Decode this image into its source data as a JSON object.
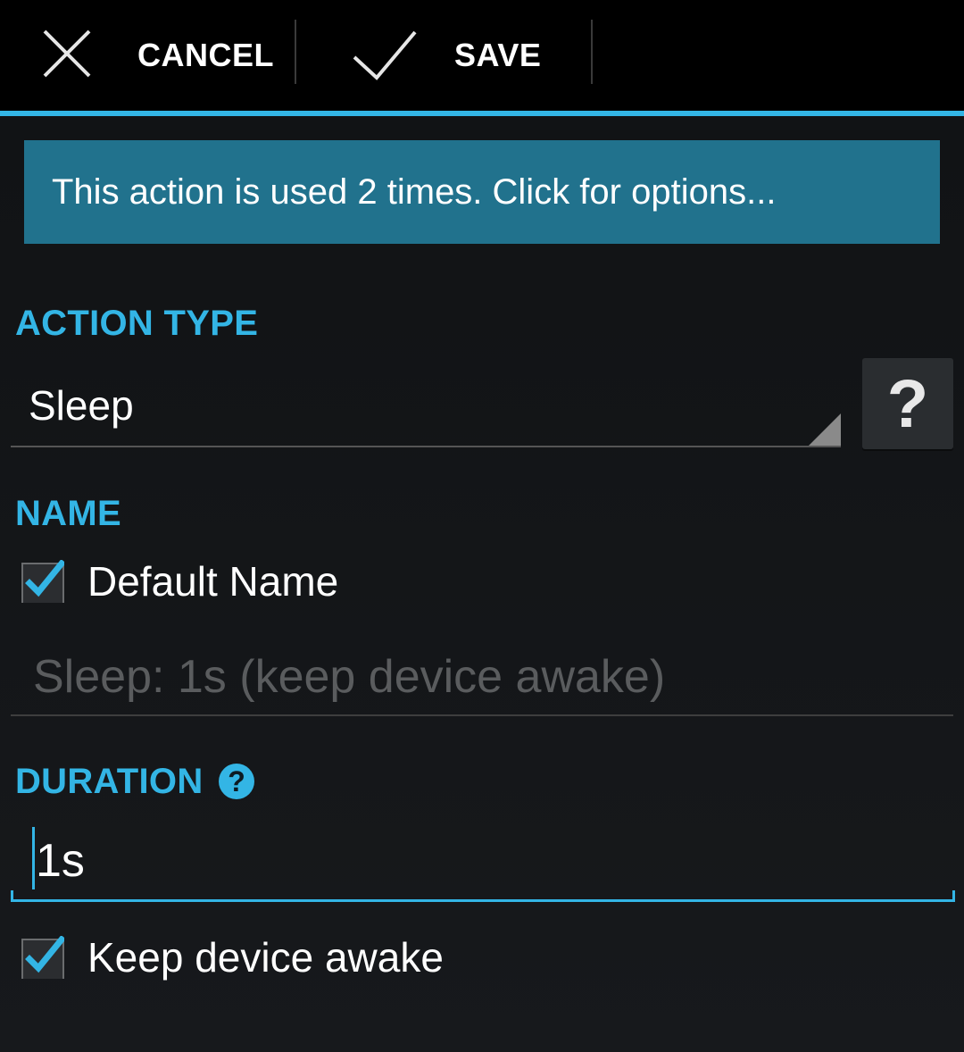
{
  "actionbar": {
    "cancel_label": "CANCEL",
    "save_label": "SAVE"
  },
  "banner": {
    "text": "This action is used 2 times. Click for options..."
  },
  "action_type": {
    "header": "ACTION TYPE",
    "selected": "Sleep",
    "help_glyph": "?"
  },
  "name": {
    "header": "NAME",
    "default_name_label": "Default Name",
    "default_name_checked": true,
    "placeholder": "Sleep: 1s (keep device awake)"
  },
  "duration": {
    "header": "DURATION",
    "help_glyph": "?",
    "value": "1s",
    "keep_awake_label": "Keep device awake",
    "keep_awake_checked": true
  },
  "colors": {
    "accent": "#33b5e5",
    "banner": "#21728d",
    "background": "#15171a"
  },
  "icons": {
    "cancel": "close-icon",
    "save": "checkmark-icon",
    "spinner": "dropdown-corner-icon",
    "help": "question-icon"
  }
}
